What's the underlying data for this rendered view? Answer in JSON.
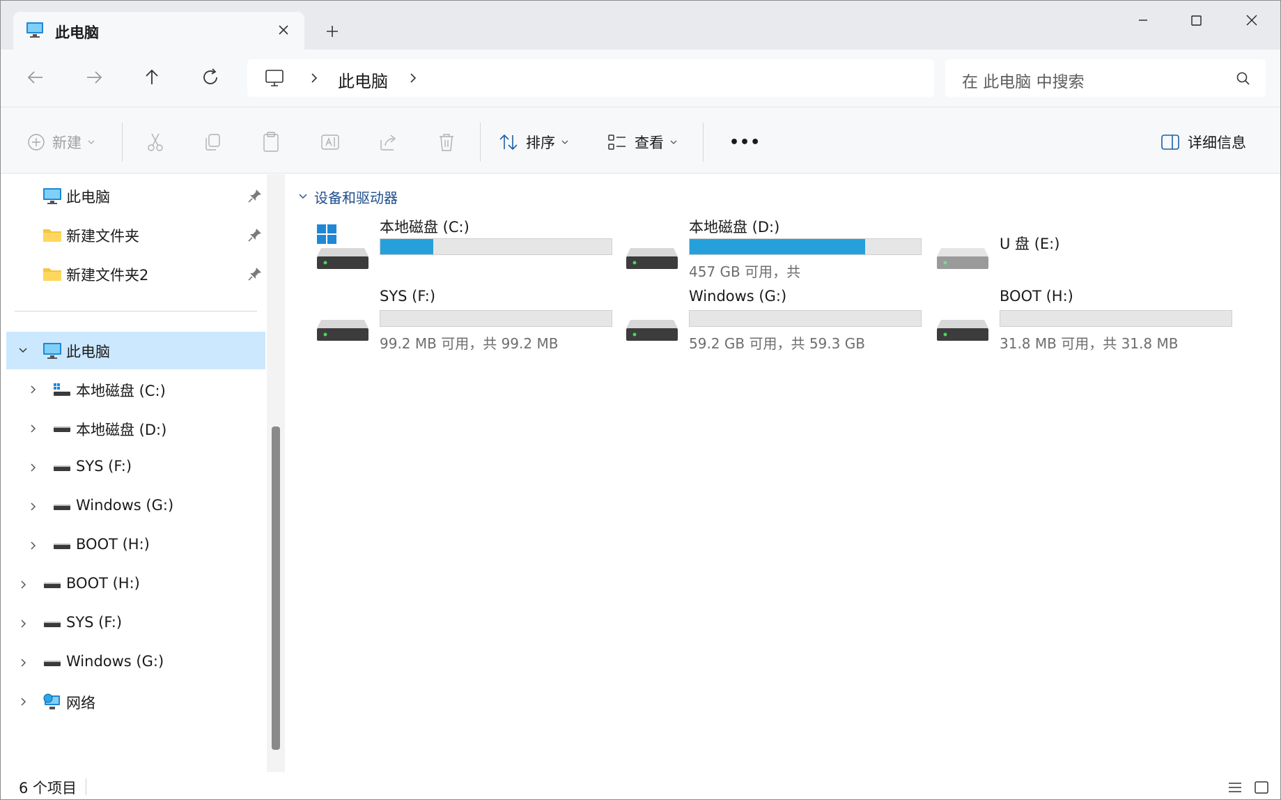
{
  "tab": {
    "title": "此电脑"
  },
  "address": {
    "crumb": "此电脑"
  },
  "search": {
    "placeholder": "在 此电脑 中搜索"
  },
  "toolbar": {
    "new_label": "新建",
    "sort_label": "排序",
    "view_label": "查看",
    "more_label": "•••",
    "details_label": "详细信息"
  },
  "sidebar": {
    "quick_access": [
      {
        "label": "此电脑"
      },
      {
        "label": "新建文件夹"
      },
      {
        "label": "新建文件夹2"
      }
    ],
    "this_pc": {
      "label": "此电脑"
    },
    "this_pc_children": [
      {
        "label": "本地磁盘 (C:)"
      },
      {
        "label": "本地磁盘 (D:)"
      },
      {
        "label": "SYS (F:)"
      },
      {
        "label": "Windows (G:)"
      },
      {
        "label": "BOOT (H:)"
      }
    ],
    "roots": [
      {
        "label": "BOOT (H:)"
      },
      {
        "label": "SYS (F:)"
      },
      {
        "label": "Windows (G:)"
      },
      {
        "label": "网络"
      }
    ]
  },
  "content": {
    "group_title": "设备和驱动器",
    "drives": [
      {
        "name": "本地磁盘 (C:)",
        "used_fraction": 0.23,
        "size_text": ""
      },
      {
        "name": "本地磁盘 (D:)",
        "used_fraction": 0.76,
        "size_text": "457 GB 可用，共"
      },
      {
        "name": "U 盘 (E:)",
        "used_fraction": null,
        "size_text": ""
      },
      {
        "name": "SYS (F:)",
        "used_fraction": 0.0,
        "size_text": "99.2 MB 可用，共 99.2 MB"
      },
      {
        "name": "Windows (G:)",
        "used_fraction": 0.0,
        "size_text": "59.2 GB 可用，共 59.3 GB"
      },
      {
        "name": "BOOT (H:)",
        "used_fraction": 0.0,
        "size_text": "31.8 MB 可用，共 31.8 MB"
      }
    ]
  },
  "status": {
    "count": "6 个项目"
  },
  "colors": {
    "accent": "#26a0da",
    "selection": "#cce8ff"
  }
}
